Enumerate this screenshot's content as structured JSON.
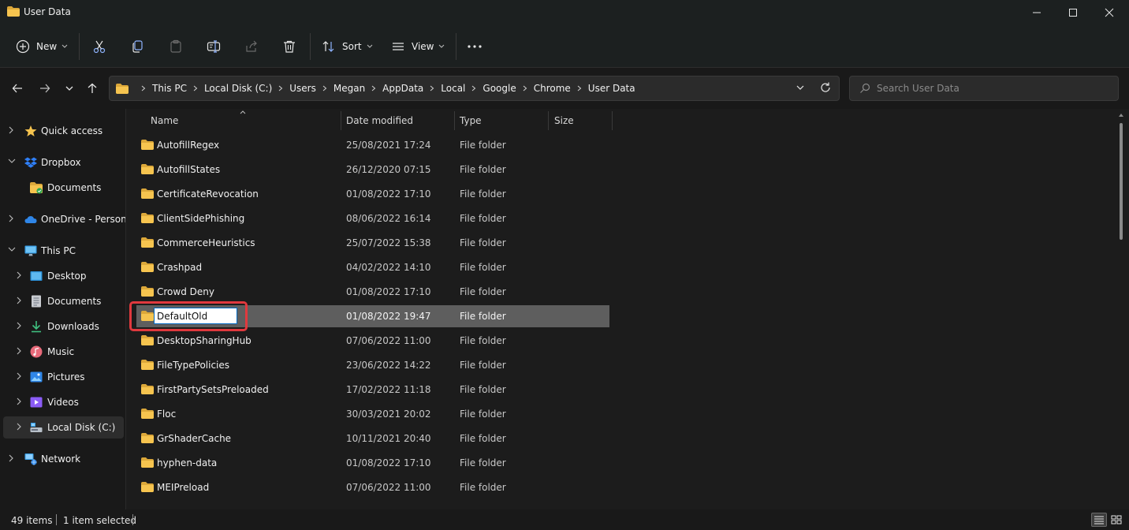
{
  "window": {
    "title": "User Data"
  },
  "toolbar": {
    "new_label": "New",
    "sort_label": "Sort",
    "view_label": "View",
    "icons": [
      "cut-icon",
      "copy-icon",
      "paste-icon",
      "rename-icon",
      "share-icon",
      "delete-icon",
      "more-icon"
    ]
  },
  "address": {
    "crumbs": [
      "This PC",
      "Local Disk (C:)",
      "Users",
      "Megan",
      "AppData",
      "Local",
      "Google",
      "Chrome",
      "User Data"
    ]
  },
  "search": {
    "placeholder": "Search User Data"
  },
  "sidebar": {
    "items": [
      {
        "label": "Quick access",
        "icon": "star-icon"
      },
      {
        "label": "Dropbox",
        "icon": "dropbox-icon"
      },
      {
        "label": "Documents",
        "icon": "folder-icon"
      },
      {
        "label": "OneDrive - Personal",
        "icon": "cloud-icon"
      },
      {
        "label": "This PC",
        "icon": "computer-icon"
      },
      {
        "label": "Desktop",
        "icon": "desktop-icon"
      },
      {
        "label": "Documents",
        "icon": "documents-icon"
      },
      {
        "label": "Downloads",
        "icon": "download-icon"
      },
      {
        "label": "Music",
        "icon": "music-icon"
      },
      {
        "label": "Pictures",
        "icon": "pictures-icon"
      },
      {
        "label": "Videos",
        "icon": "videos-icon"
      },
      {
        "label": "Local Disk (C:)",
        "icon": "drive-icon"
      },
      {
        "label": "Network",
        "icon": "network-icon"
      }
    ],
    "selected": "Local Disk (C:)"
  },
  "columns": {
    "name": "Name",
    "date": "Date modified",
    "type": "Type",
    "size": "Size"
  },
  "files": [
    {
      "name": "AutofillRegex",
      "date": "25/08/2021 17:24",
      "type": "File folder"
    },
    {
      "name": "AutofillStates",
      "date": "26/12/2020 07:15",
      "type": "File folder"
    },
    {
      "name": "CertificateRevocation",
      "date": "01/08/2022 17:10",
      "type": "File folder"
    },
    {
      "name": "ClientSidePhishing",
      "date": "08/06/2022 16:14",
      "type": "File folder"
    },
    {
      "name": "CommerceHeuristics",
      "date": "25/07/2022 15:38",
      "type": "File folder"
    },
    {
      "name": "Crashpad",
      "date": "04/02/2022 14:10",
      "type": "File folder"
    },
    {
      "name": "Crowd Deny",
      "date": "01/08/2022 17:10",
      "type": "File folder"
    },
    {
      "name": "DefaultOld",
      "date": "01/08/2022 19:47",
      "type": "File folder",
      "selected": true,
      "renaming": true
    },
    {
      "name": "DesktopSharingHub",
      "date": "07/06/2022 11:00",
      "type": "File folder"
    },
    {
      "name": "FileTypePolicies",
      "date": "23/06/2022 14:22",
      "type": "File folder"
    },
    {
      "name": "FirstPartySetsPreloaded",
      "date": "17/02/2022 11:18",
      "type": "File folder"
    },
    {
      "name": "Floc",
      "date": "30/03/2021 20:02",
      "type": "File folder"
    },
    {
      "name": "GrShaderCache",
      "date": "10/11/2021 20:40",
      "type": "File folder"
    },
    {
      "name": "hyphen-data",
      "date": "01/08/2022 17:10",
      "type": "File folder"
    },
    {
      "name": "MEIPreload",
      "date": "07/06/2022 11:00",
      "type": "File folder"
    }
  ],
  "status": {
    "item_count": "49 items",
    "selection": "1 item selected"
  },
  "colors": {
    "folder": "#f6c44f",
    "folder_dark": "#dca83a",
    "selection": "#5e5e5e",
    "highlight": "#e0393e",
    "accent": "#0067c0"
  }
}
